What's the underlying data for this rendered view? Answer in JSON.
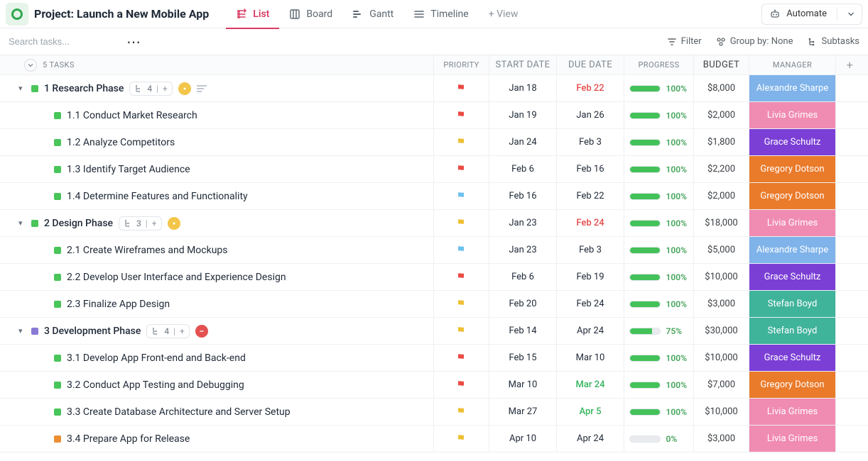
{
  "header": {
    "title": "Project: Launch a New Mobile App",
    "views": [
      "List",
      "Board",
      "Gantt",
      "Timeline"
    ],
    "active_view": 0,
    "add_view": "+ View",
    "automate": "Automate"
  },
  "toolbar": {
    "search_placeholder": "Search tasks...",
    "filter": "Filter",
    "groupby": "Group by: None",
    "subtasks": "Subtasks"
  },
  "columns": {
    "tasks_count": "5 TASKS",
    "priority": "PRIORITY",
    "start": "START DATE",
    "due": "DUE DATE",
    "progress": "PROGRESS",
    "budget": "BUDGET",
    "manager": "MANAGER"
  },
  "managers": {
    "alex": {
      "name": "Alexandre Sharpe",
      "color": "#7fb3ea"
    },
    "livia": {
      "name": "Livia Grimes",
      "color": "#f08bb1"
    },
    "grace": {
      "name": "Grace Schultz",
      "color": "#7b3fd6"
    },
    "greg": {
      "name": "Gregory Dotson",
      "color": "#ea7b2b"
    },
    "stefan": {
      "name": "Stefan Boyd",
      "color": "#40b39b"
    }
  },
  "tasks": [
    {
      "type": "parent",
      "sq": "#49c55a",
      "name": "1 Research Phase",
      "sub_count": 4,
      "status": "yellow",
      "has_desc": true,
      "priority": "red",
      "start": "Jan 18",
      "due": "Feb 22",
      "due_style": "overdue",
      "progress": 100,
      "budget": "$8,000",
      "manager": "alex",
      "plus": true
    },
    {
      "type": "sub",
      "sq": "#49c55a",
      "name": "1.1 Conduct Market Research",
      "priority": "red",
      "start": "Jan 19",
      "due": "Jan 26",
      "progress": 100,
      "budget": "$2,000",
      "manager": "livia"
    },
    {
      "type": "sub",
      "sq": "#49c55a",
      "name": "1.2 Analyze Competitors",
      "priority": "yellow",
      "start": "Jan 24",
      "due": "Feb 3",
      "progress": 100,
      "budget": "$1,800",
      "manager": "grace"
    },
    {
      "type": "sub",
      "sq": "#49c55a",
      "name": "1.3 Identify Target Audience",
      "priority": "red",
      "start": "Feb 6",
      "due": "Feb 16",
      "progress": 100,
      "budget": "$2,200",
      "manager": "greg"
    },
    {
      "type": "sub",
      "sq": "#49c55a",
      "name": "1.4 Determine Features and Functionality",
      "priority": "blue",
      "start": "Feb 16",
      "due": "Feb 22",
      "progress": 100,
      "budget": "$2,000",
      "manager": "greg"
    },
    {
      "type": "parent",
      "sq": "#49c55a",
      "name": "2 Design Phase",
      "sub_count": 3,
      "status": "yellow",
      "priority": "yellow",
      "start": "Jan 23",
      "due": "Feb 24",
      "due_style": "overdue",
      "progress": 100,
      "budget": "$18,000",
      "manager": "livia",
      "plus": true
    },
    {
      "type": "sub",
      "sq": "#49c55a",
      "name": "2.1 Create Wireframes and Mockups",
      "priority": "blue",
      "start": "Jan 23",
      "due": "Feb 3",
      "progress": 100,
      "budget": "$5,000",
      "manager": "alex"
    },
    {
      "type": "sub",
      "sq": "#49c55a",
      "name": "2.2 Develop User Interface and Experience Design",
      "priority": "red",
      "start": "Feb 6",
      "due": "Feb 19",
      "progress": 100,
      "budget": "$10,000",
      "manager": "grace"
    },
    {
      "type": "sub",
      "sq": "#49c55a",
      "name": "2.3 Finalize App Design",
      "priority": "yellow",
      "start": "Feb 20",
      "due": "Feb 24",
      "progress": 100,
      "budget": "$3,000",
      "manager": "stefan"
    },
    {
      "type": "parent",
      "sq": "#8a7ad6",
      "name": "3 Development Phase",
      "sub_count": 4,
      "status": "red",
      "priority": "yellow",
      "start": "Feb 14",
      "due": "Apr 24",
      "progress": 75,
      "budget": "$30,000",
      "manager": "stefan",
      "plus": true
    },
    {
      "type": "sub",
      "sq": "#49c55a",
      "name": "3.1 Develop App Front-end and Back-end",
      "priority": "red",
      "start": "Feb 15",
      "due": "Mar 10",
      "progress": 100,
      "budget": "$10,000",
      "manager": "grace"
    },
    {
      "type": "sub",
      "sq": "#49c55a",
      "name": "3.2 Conduct App Testing and Debugging",
      "priority": "red",
      "start": "Mar 10",
      "due": "Mar 24",
      "due_style": "green",
      "progress": 100,
      "budget": "$7,000",
      "manager": "greg"
    },
    {
      "type": "sub",
      "sq": "#49c55a",
      "name": "3.3 Create Database Architecture and Server Setup",
      "priority": "yellow",
      "start": "Mar 27",
      "due": "Apr 5",
      "due_style": "green",
      "progress": 100,
      "budget": "$10,000",
      "manager": "livia"
    },
    {
      "type": "sub",
      "sq": "#eb8f35",
      "name": "3.4 Prepare App for Release",
      "priority": "yellow",
      "start": "Apr 10",
      "due": "Apr 24",
      "progress": 0,
      "budget": "$3,000",
      "manager": "livia"
    }
  ]
}
